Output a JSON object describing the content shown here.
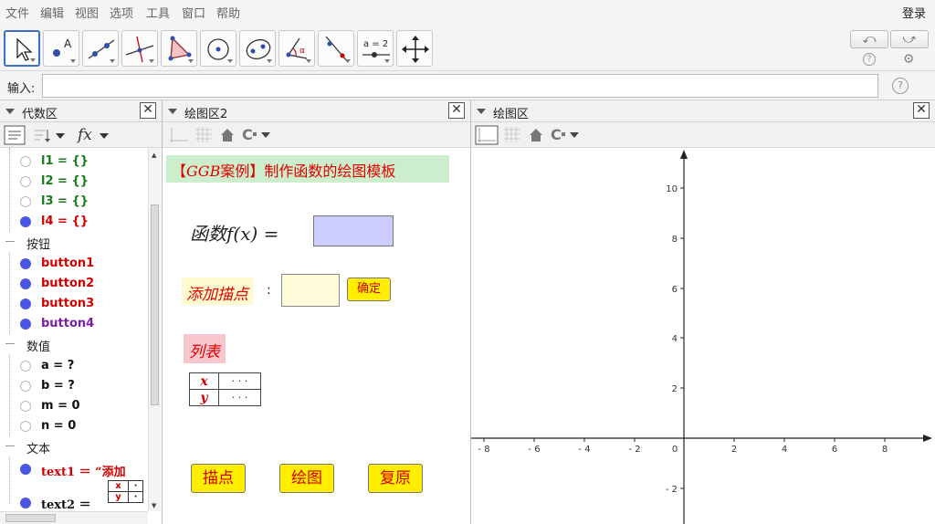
{
  "menubar": {
    "items": [
      "文件",
      "编辑",
      "视图",
      "选项",
      "工具",
      "窗口",
      "帮助"
    ],
    "login": "登录"
  },
  "toolbar": {
    "tools": [
      "move-tool",
      "point-tool",
      "line-tool",
      "perpendicular-line-tool",
      "polygon-tool",
      "circle-tool",
      "ellipse-tool",
      "angle-tool",
      "reflect-tool",
      "slider-tool",
      "move-view-tool"
    ],
    "slider_label": "a = 2",
    "undo": "⤺",
    "redo": "⤻"
  },
  "input": {
    "label": "输入:",
    "value": ""
  },
  "algebra": {
    "title": "代数区",
    "items": [
      {
        "kind": "item",
        "label": "l1 = {}",
        "color": "green",
        "on": false
      },
      {
        "kind": "item",
        "label": "l2 = {}",
        "color": "green",
        "on": false
      },
      {
        "kind": "item",
        "label": "l3 = {}",
        "color": "green",
        "on": false
      },
      {
        "kind": "item",
        "label": "l4 = {}",
        "color": "red",
        "on": true
      },
      {
        "kind": "cat",
        "label": "按钮"
      },
      {
        "kind": "item",
        "label": "button1",
        "color": "red",
        "on": true
      },
      {
        "kind": "item",
        "label": "button2",
        "color": "red",
        "on": true
      },
      {
        "kind": "item",
        "label": "button3",
        "color": "red",
        "on": true
      },
      {
        "kind": "item",
        "label": "button4",
        "color": "purple",
        "on": true
      },
      {
        "kind": "cat",
        "label": "数值"
      },
      {
        "kind": "item",
        "label": "a = ?",
        "color": "black",
        "on": false
      },
      {
        "kind": "item",
        "label": "b = ?",
        "color": "black",
        "on": false
      },
      {
        "kind": "item",
        "label": "m = 0",
        "color": "black",
        "on": false
      },
      {
        "kind": "item",
        "label": "n = 0",
        "color": "black",
        "on": false
      },
      {
        "kind": "cat",
        "label": "文本"
      },
      {
        "kind": "item",
        "label": "text1 ＝ “添加",
        "color": "red",
        "on": true
      },
      {
        "kind": "item",
        "label": "text2 ＝",
        "color": "black",
        "on": true
      }
    ],
    "text2_table": [
      "x",
      "·",
      "y",
      "·"
    ]
  },
  "graphics2": {
    "title": "绘图区2",
    "banner_pre": "【",
    "banner_it": "GGB",
    "banner_post": "案例】制作函数的绘图模板",
    "func_label_pre": "函数",
    "func_label_f": "f",
    "func_label_post": "(x) =",
    "add_point_label": "添加描点",
    "colon": ":",
    "confirm": "确定",
    "list_label": "列表",
    "table": {
      "x": "x",
      "y": "y",
      "xv": "· · ·",
      "yv": "· · ·"
    },
    "buttons": [
      "描点",
      "绘图",
      "复原"
    ]
  },
  "graphics": {
    "title": "绘图区",
    "x_ticks": [
      "- 8",
      "- 6",
      "- 4",
      "- 2",
      "0",
      "2",
      "4",
      "6",
      "8"
    ],
    "y_ticks": [
      "10",
      "8",
      "6",
      "4",
      "2",
      "- 2"
    ]
  }
}
